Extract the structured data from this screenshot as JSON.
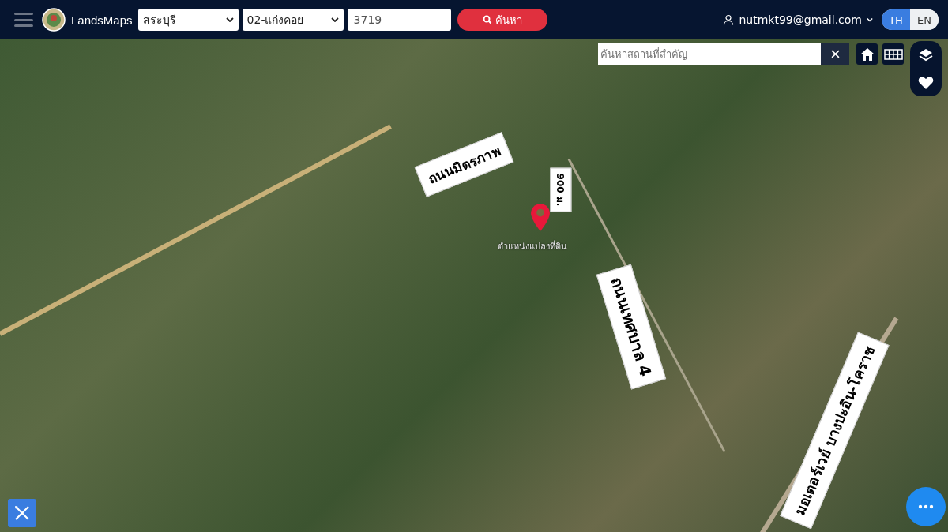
{
  "header": {
    "brand": "LandsMaps",
    "province": "สระบุรี",
    "district": "02-แก่งคอย",
    "parcel_number": "3719",
    "search_button": "ค้นหา",
    "user_email": "nutmkt99@gmail.com",
    "languages": [
      {
        "label": "TH",
        "selected": true
      },
      {
        "label": "EN",
        "selected": false
      }
    ]
  },
  "map": {
    "place_search": {
      "placeholder": "ค้นหาสถานที่สำคัญ"
    },
    "pin_label": "ตำแหน่งแปลงที่ดิน",
    "callouts": [
      {
        "text": "ถนนมิตรภาพ",
        "kind": "tilt-left"
      },
      {
        "text": "900 ม.",
        "kind": "down"
      },
      {
        "text": "ถนนเทศบาล 4",
        "kind": "tilt-down"
      },
      {
        "text": "มอเตอร์เวย์ บางปะอิน-โคราช",
        "kind": "up"
      }
    ]
  }
}
